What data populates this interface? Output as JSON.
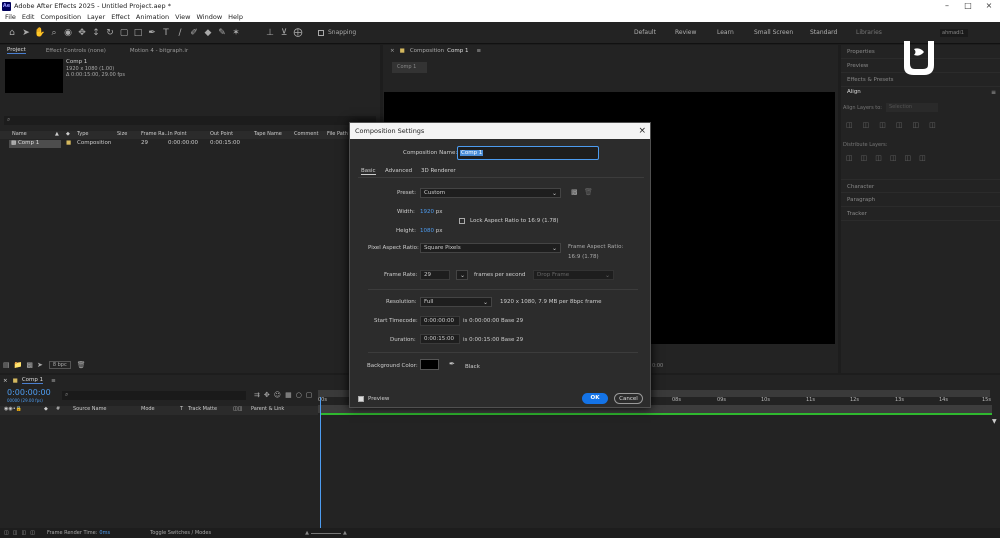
{
  "window": {
    "title": "Adobe After Effects 2025 - Untitled Project.aep *",
    "app_badge": "Ae"
  },
  "menu": [
    "File",
    "Edit",
    "Composition",
    "Layer",
    "Effect",
    "Animation",
    "View",
    "Window",
    "Help"
  ],
  "toolbar": {
    "snapping_label": "Snapping"
  },
  "workspaces": [
    "Default",
    "Review",
    "Learn",
    "Small Screen",
    "Standard",
    "Libraries"
  ],
  "workspace_user": "ahmadi1",
  "project_panel": {
    "tabs": [
      "Project",
      "Effect Controls (none)",
      "Motion 4 - bitgraph.ir"
    ],
    "comp_name": "Comp 1",
    "comp_info1": "1920 x 1080 (1.00)",
    "comp_info2": "Δ 0:00:15:00, 29.00 fps",
    "search_placeholder": "⌕",
    "columns": [
      "Name",
      "",
      "Type",
      "Size",
      "Frame Ra...",
      "In Point",
      "Out Point",
      "Tape Name",
      "Comment",
      "File Path"
    ],
    "rows": [
      {
        "name": "Comp 1",
        "type": "Composition",
        "size": "",
        "fps": "29",
        "in": "0:00:00:00",
        "out": "0:00:15:00"
      }
    ],
    "bpc": "8 bpc"
  },
  "comp_viewer": {
    "tab_label": "Composition",
    "tab_comp": "Comp 1",
    "breadcrumb": "Comp 1",
    "timecode_fragment": "0:00"
  },
  "right_panel": {
    "properties": "Properties",
    "preview": "Preview",
    "effects": "Effects & Presets",
    "align": "Align",
    "align_layers_to": "Align Layers to:",
    "align_target": "Selection",
    "distribute": "Distribute Layers:",
    "character": "Character",
    "paragraph": "Paragraph",
    "tracker": "Tracker"
  },
  "timeline": {
    "tab": "Comp 1",
    "timecode": "0:00:00:00",
    "timecode_sub": "00000 (29.00 fps)",
    "columns": [
      "#",
      "Source Name",
      "Mode",
      "T",
      "Track Matte",
      "Parent & Link"
    ],
    "ruler": [
      "00s",
      "08s",
      "09s",
      "10s",
      "11s",
      "12s",
      "13s",
      "14s",
      "15s"
    ],
    "footer_render_label": "Frame Render Time:",
    "footer_render_value": "0ms",
    "footer_toggle": "Toggle Switches / Modes"
  },
  "dialog": {
    "title": "Composition Settings",
    "name_label": "Composition Name:",
    "name_value": "Comp 1",
    "tabs": [
      "Basic",
      "Advanced",
      "3D Renderer"
    ],
    "preset_label": "Preset:",
    "preset_value": "Custom",
    "width_label": "Width:",
    "width_value": "1920",
    "height_label": "Height:",
    "height_value": "1080",
    "px": "px",
    "lock_label": "Lock Aspect Ratio to 16:9 (1.78)",
    "par_label": "Pixel Aspect Ratio:",
    "par_value": "Square Pixels",
    "far_label": "Frame Aspect Ratio:",
    "far_value": "16:9 (1.78)",
    "fps_label": "Frame Rate:",
    "fps_value": "29",
    "fps_unit": "frames per second",
    "drop_frame": "Drop Frame",
    "res_label": "Resolution:",
    "res_value": "Full",
    "res_info": "1920 x 1080, 7.9 MB per 8bpc frame",
    "start_label": "Start Timecode:",
    "start_value": "0:00:00:00",
    "start_info": "is 0:00:00:00  Base 29",
    "dur_label": "Duration:",
    "dur_value": "0:00:15:00",
    "dur_info": "is 0:00:15:00  Base 29",
    "bg_label": "Background Color:",
    "bg_name": "Black",
    "preview_label": "Preview",
    "ok": "OK",
    "cancel": "Cancel"
  }
}
